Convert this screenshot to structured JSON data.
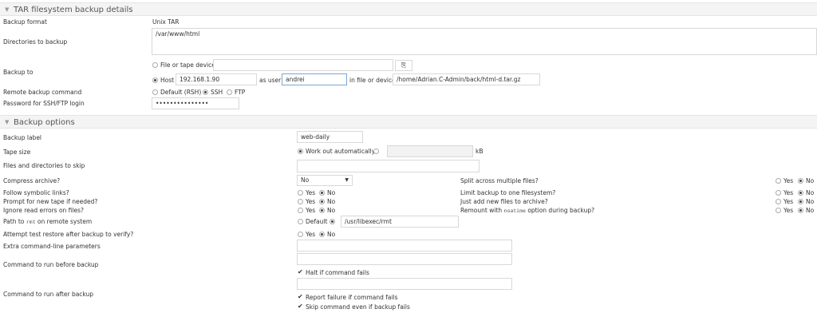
{
  "tar": {
    "title": "TAR filesystem backup details",
    "format_label": "Backup format",
    "format_value": "Unix TAR",
    "dirs_label": "Directories to backup",
    "dirs_value": "/var/www/html",
    "backup_to_label": "Backup to",
    "file_or_tape": "File or tape device",
    "host_label": "Host",
    "host_value": "192.168.1.90",
    "as_user": "as user",
    "user_value": "andrei",
    "in_file": "in file or device",
    "file_value": "/home/Adrian.C-Admin/back/html-d.tar.gz",
    "remote_cmd_label": "Remote backup command",
    "rsh": "Default (RSH)",
    "ssh": "SSH",
    "ftp": "FTP",
    "password_label": "Password for SSH/FTP login",
    "password_value": "•••••••••••••••"
  },
  "opts": {
    "title": "Backup options",
    "label_label": "Backup label",
    "label_value": "web-daily",
    "tape_size_label": "Tape size",
    "work_out": "Work out automatically",
    "kb": "kB",
    "skip_label": "Files and directories to skip",
    "compress_label": "Compress archive?",
    "compress_value": "No",
    "split_label": "Split across multiple files?",
    "symlinks_label": "Follow symbolic links?",
    "limit_fs_label": "Limit backup to one filesystem?",
    "prompt_tape_label": "Prompt for new tape if needed?",
    "add_new_label": "Just add new files to archive?",
    "ignore_errors_label": "Ignore read errors on files?",
    "remount_pre": "Remount with",
    "remount_code": "noatime",
    "remount_post": "option during backup?",
    "rmt_pre": "Path to",
    "rmt_code": "rmt",
    "rmt_post": "on remote system",
    "rmt_default": "Default",
    "rmt_value": "/usr/libexec/rmt",
    "verify_label": "Attempt test restore after backup to verify?",
    "extra_label": "Extra command-line parameters",
    "before_label": "Command to run before backup",
    "halt_label": "Halt if command fails",
    "after_label": "Command to run after backup",
    "report_label": "Report failure if command fails",
    "skip_cmd_label": "Skip command even if backup fails",
    "yes": "Yes",
    "no": "No"
  }
}
